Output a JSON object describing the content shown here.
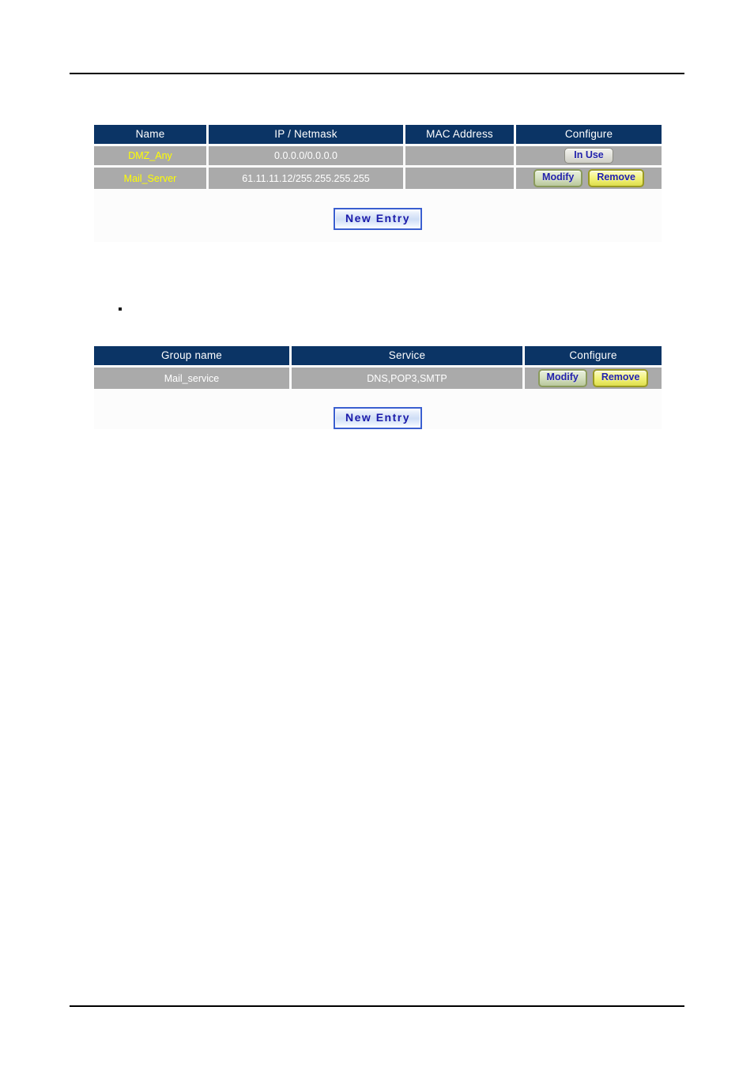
{
  "page": {
    "background_color": "#ffffff",
    "rule_color": "#000000",
    "marker": "."
  },
  "theme": {
    "header_bg": "#0b3465",
    "header_text": "#ffffff",
    "row_bg": "#aaaaaa",
    "row_text": "#ffffff",
    "name_text": "#ffff00",
    "panel_bg": "#fcfcfc",
    "button_text": "#2222aa",
    "new_entry_text": "#1a1aaa"
  },
  "address_book": {
    "columns": [
      "Name",
      "IP / Netmask",
      "MAC Address",
      "Configure"
    ],
    "rows": [
      {
        "name": "DMZ_Any",
        "ip_netmask": "0.0.0.0/0.0.0.0",
        "mac_address": "",
        "actions": [
          {
            "label": "In Use",
            "style": "inuse",
            "icon": "lock-icon"
          }
        ]
      },
      {
        "name": "Mail_Server",
        "ip_netmask": "61.11.11.12/255.255.255.255",
        "mac_address": "",
        "actions": [
          {
            "label": "Modify",
            "style": "modify",
            "icon": "pencil-icon"
          },
          {
            "label": "Remove",
            "style": "remove",
            "icon": "trash-icon"
          }
        ]
      }
    ],
    "new_entry_label": "New Entry"
  },
  "service_group": {
    "columns": [
      "Group name",
      "Service",
      "Configure"
    ],
    "rows": [
      {
        "group_name": "Mail_service",
        "service": "DNS,POP3,SMTP",
        "actions": [
          {
            "label": "Modify",
            "style": "modify",
            "icon": "pencil-icon"
          },
          {
            "label": "Remove",
            "style": "remove",
            "icon": "trash-icon"
          }
        ]
      }
    ],
    "new_entry_label": "New Entry"
  }
}
